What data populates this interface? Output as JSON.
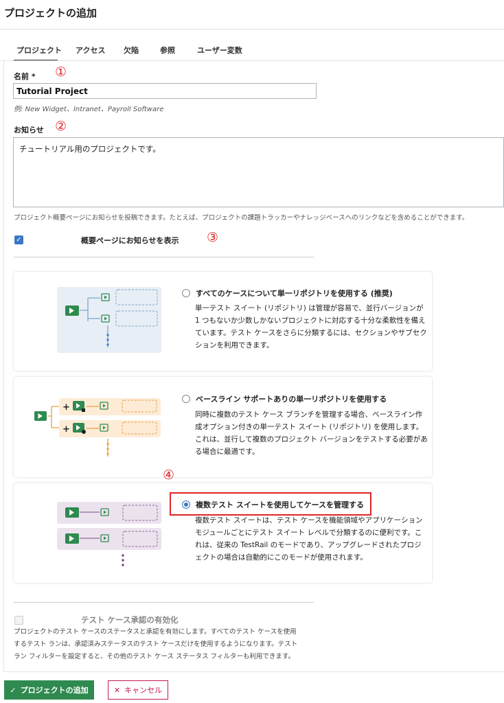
{
  "page": {
    "title": "プロジェクトの追加"
  },
  "tabs": [
    "プロジェクト",
    "アクセス",
    "欠陥",
    "参照",
    "ユーザー変数"
  ],
  "markers": [
    "①",
    "②",
    "③",
    "④"
  ],
  "name_field": {
    "label": "名前",
    "required_mark": "*",
    "value": "Tutorial Project",
    "hint": "例: New Widget、Intranet、Payroll Software"
  },
  "announcement": {
    "label": "お知らせ",
    "value": "チュートリアル用のプロジェクトです。",
    "hint": "プロジェクト概要ページにお知らせを投稿できます。たとえば、プロジェクトの課題トラッカーやナレッジベースへのリンクなどを含めることができます。"
  },
  "show_announcement": {
    "label": "概要ページにお知らせを表示",
    "checked": true
  },
  "suite_options": [
    {
      "title": "すべてのケースについて単一リポジトリを使用する (推奨)",
      "selected": false,
      "description": "単一テスト スイート (リポジトリ) は管理が容易で、並行バージョンが 1 つもないか少数しかないプロジェクトに対応する十分な柔軟性を備えています。テスト ケースをさらに分類するには、セクションやサブセクションを利用できます。",
      "accent": "#2f8a50",
      "bg": "#e8eef5"
    },
    {
      "title": "ベースライン サポートありの単一リポジトリを使用する",
      "selected": false,
      "description": "同時に複数のテスト ケース ブランチを管理する場合、ベースライン作成オプション付きの単一テスト スイート (リポジトリ) を使用します。これは、並行して複数のプロジェクト バージョンをテストする必要がある場合に最適です。",
      "accent": "#2f8a50",
      "bg": "#fdebd6"
    },
    {
      "title": "複数テスト スイートを使用してケースを管理する",
      "selected": true,
      "description": "複数テスト スイートは、テスト ケースを機能領域やアプリケーション モジュールごとにテスト スイート レベルで分類するのに便利です。これは、従来の TestRail のモードであり、アップグレードされたプロジェクトの場合は自動的にこのモードが使用されます。",
      "accent": "#2f8a50",
      "bg": "#ece2ee"
    }
  ],
  "approval": {
    "label": "テスト ケース承認の有効化",
    "checked": false,
    "description": "プロジェクトのテスト ケースのステータスと承認を有効にします。すべてのテスト ケースを使用するテスト ランは、承認済みステータスのテスト ケースだけを使用するようになります。テスト ラン フィルターを設定すると、その他のテスト ケース ステータス フィルターも利用できます。"
  },
  "buttons": {
    "add": "プロジェクトの追加",
    "cancel": "キャンセル"
  },
  "colors": {
    "primary": "#2f8a50",
    "danger": "#c01a4a",
    "marker": "#e02424",
    "checkbox": "#3b78c4"
  },
  "icons": {
    "add": "check-icon",
    "cancel": "close-icon"
  }
}
